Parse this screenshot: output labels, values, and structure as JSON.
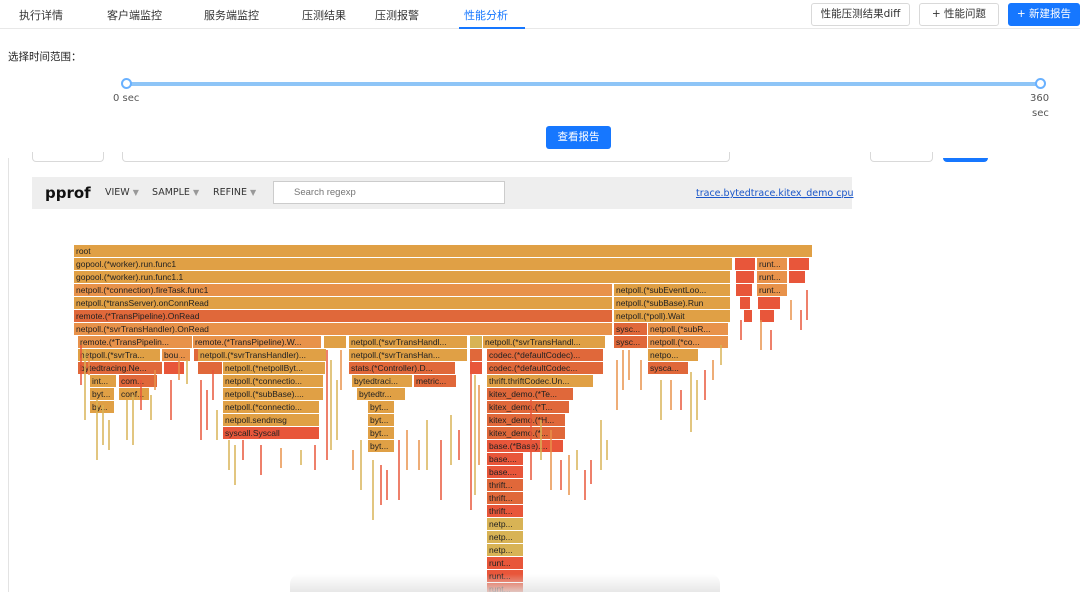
{
  "tabs": [
    "执行详情",
    "客户端监控",
    "服务端监控",
    "压测结果",
    "压测报警",
    "性能分析"
  ],
  "active_tab": "性能分析",
  "actions": {
    "diff": "性能压测结果diff",
    "issue": "+ 性能问题",
    "new_report": "+ 新建报告"
  },
  "time_range": {
    "label": "选择时间范围：",
    "start": "0 sec",
    "end_value": "360",
    "end_unit": "sec",
    "view_button": "查看报告"
  },
  "pprof": {
    "title": "pprof",
    "menus": [
      "VIEW",
      "SAMPLE",
      "REFINE"
    ],
    "search_placeholder": "Search regexp",
    "profile_link": "trace.bytedtrace.kitex_demo cpu"
  },
  "colors": {
    "accent": "#1677ff",
    "flame_dark": "#e0683a",
    "flame_mid": "#e0a045",
    "flame_light": "#d8b355"
  },
  "flame_labels": [
    "root",
    "gopool.(*worker).run.func1",
    "gopool.(*worker).run.func1.1",
    "netpoll.(*connection).fireTask.func1",
    "netpoll.(*transServer).onConnRead",
    "remote.(*TransPipeline).OnRead",
    "netpoll.(*svrTransHandler).OnRead",
    "runt...",
    "netpoll.(*subEventLoo...",
    "netpoll.(*subBase).Run",
    "netpoll.(*poll).Wait",
    "sysc...",
    "netpoll.(*subR...",
    "netpoll.(*co...",
    "netpo...",
    "sysca...",
    "remote.(*TransPipelin...",
    "remote.(*TransPipeline).W...",
    "netpoll.(*svrTransHandl...",
    "netpoll.(*svrTra...",
    "bou...",
    "netpoll.(*svrTransHandler)...",
    "netpoll.(*svrTransHan...",
    "codec.(*defaultCodec)...",
    "bytedtracing.Ne...",
    "netpoll.(*netpollByt...",
    "stats.(*Controller).D...",
    "codec.(*defaultCodec...",
    "int...",
    "com...",
    "netpoll.(*connectio...",
    "bytedtraci...",
    "metric...",
    "thrift.thriftCodec.Un...",
    "byt...",
    "conf...",
    "netpoll.(*subBase)....",
    "bytedtr...",
    "kitex_demo.(*Te...",
    "by...",
    "kitex_demo.(*T...",
    "netpoll.sendmsg",
    "kitex_demo.(*H...",
    "syscall.Syscall",
    "kitex_demo.(*...",
    "base.(*Base)....",
    "base....",
    "thrift...",
    "netp...",
    "runt...",
    "runt..."
  ]
}
